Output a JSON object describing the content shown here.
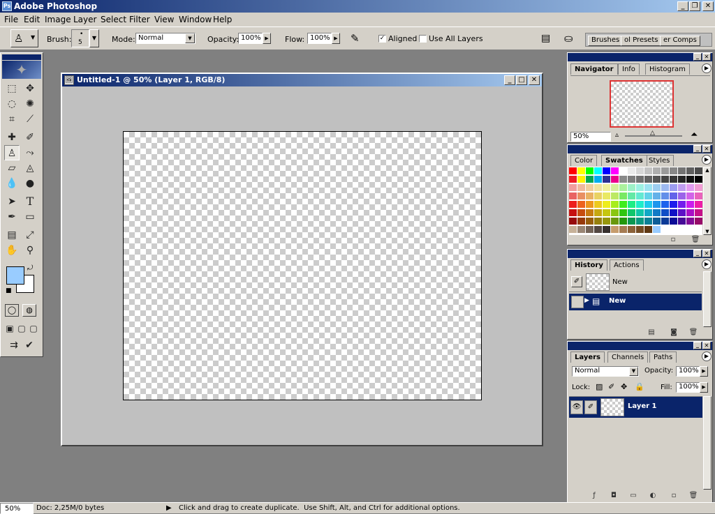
{
  "app": {
    "title": "Adobe Photoshop"
  },
  "menubar": [
    "File",
    "Edit",
    "Image",
    "Layer",
    "Select",
    "Filter",
    "View",
    "Window",
    "Help"
  ],
  "options": {
    "brush_label": "Brush:",
    "brush_size": "5",
    "mode_label": "Mode:",
    "mode_value": "Normal",
    "opacity_label": "Opacity:",
    "opacity_value": "100%",
    "flow_label": "Flow:",
    "flow_value": "100%",
    "aligned_label": "Aligned",
    "aligned_checked": true,
    "use_all_layers_label": "Use All Layers",
    "use_all_layers_checked": false
  },
  "well": {
    "tabs": [
      "Brushes",
      "ol Presets",
      "er Comps"
    ]
  },
  "document": {
    "title": "Untitled-1 @ 50% (Layer 1, RGB/8)"
  },
  "colors": {
    "foreground": "#99ccff",
    "background": "#ffffff",
    "accent": "#0a246a"
  },
  "navigator": {
    "tabs": [
      "Navigator",
      "Info",
      "Histogram"
    ],
    "zoom": "50%"
  },
  "swatches_panel": {
    "tabs": [
      "Color",
      "Swatches",
      "Styles"
    ]
  },
  "history": {
    "tabs": [
      "History",
      "Actions"
    ],
    "snapshot_label": "New",
    "items": [
      "New"
    ]
  },
  "layers": {
    "tabs": [
      "Layers",
      "Channels",
      "Paths"
    ],
    "blend_mode": "Normal",
    "opacity_label": "Opacity:",
    "opacity_value": "100%",
    "lock_label": "Lock:",
    "fill_label": "Fill:",
    "fill_value": "100%",
    "layer_name": "Layer 1"
  },
  "statusbar": {
    "zoom": "50%",
    "doc_info": "Doc: 2,25M/0 bytes",
    "hint": "Click and drag to create duplicate.  Use Shift, Alt, and Ctrl for additional options."
  },
  "icons": [
    "clone-stamp-icon",
    "brush-preset-icon",
    "airbrush-icon",
    "palette-well-icon",
    "eye-icon",
    "trash-icon"
  ]
}
